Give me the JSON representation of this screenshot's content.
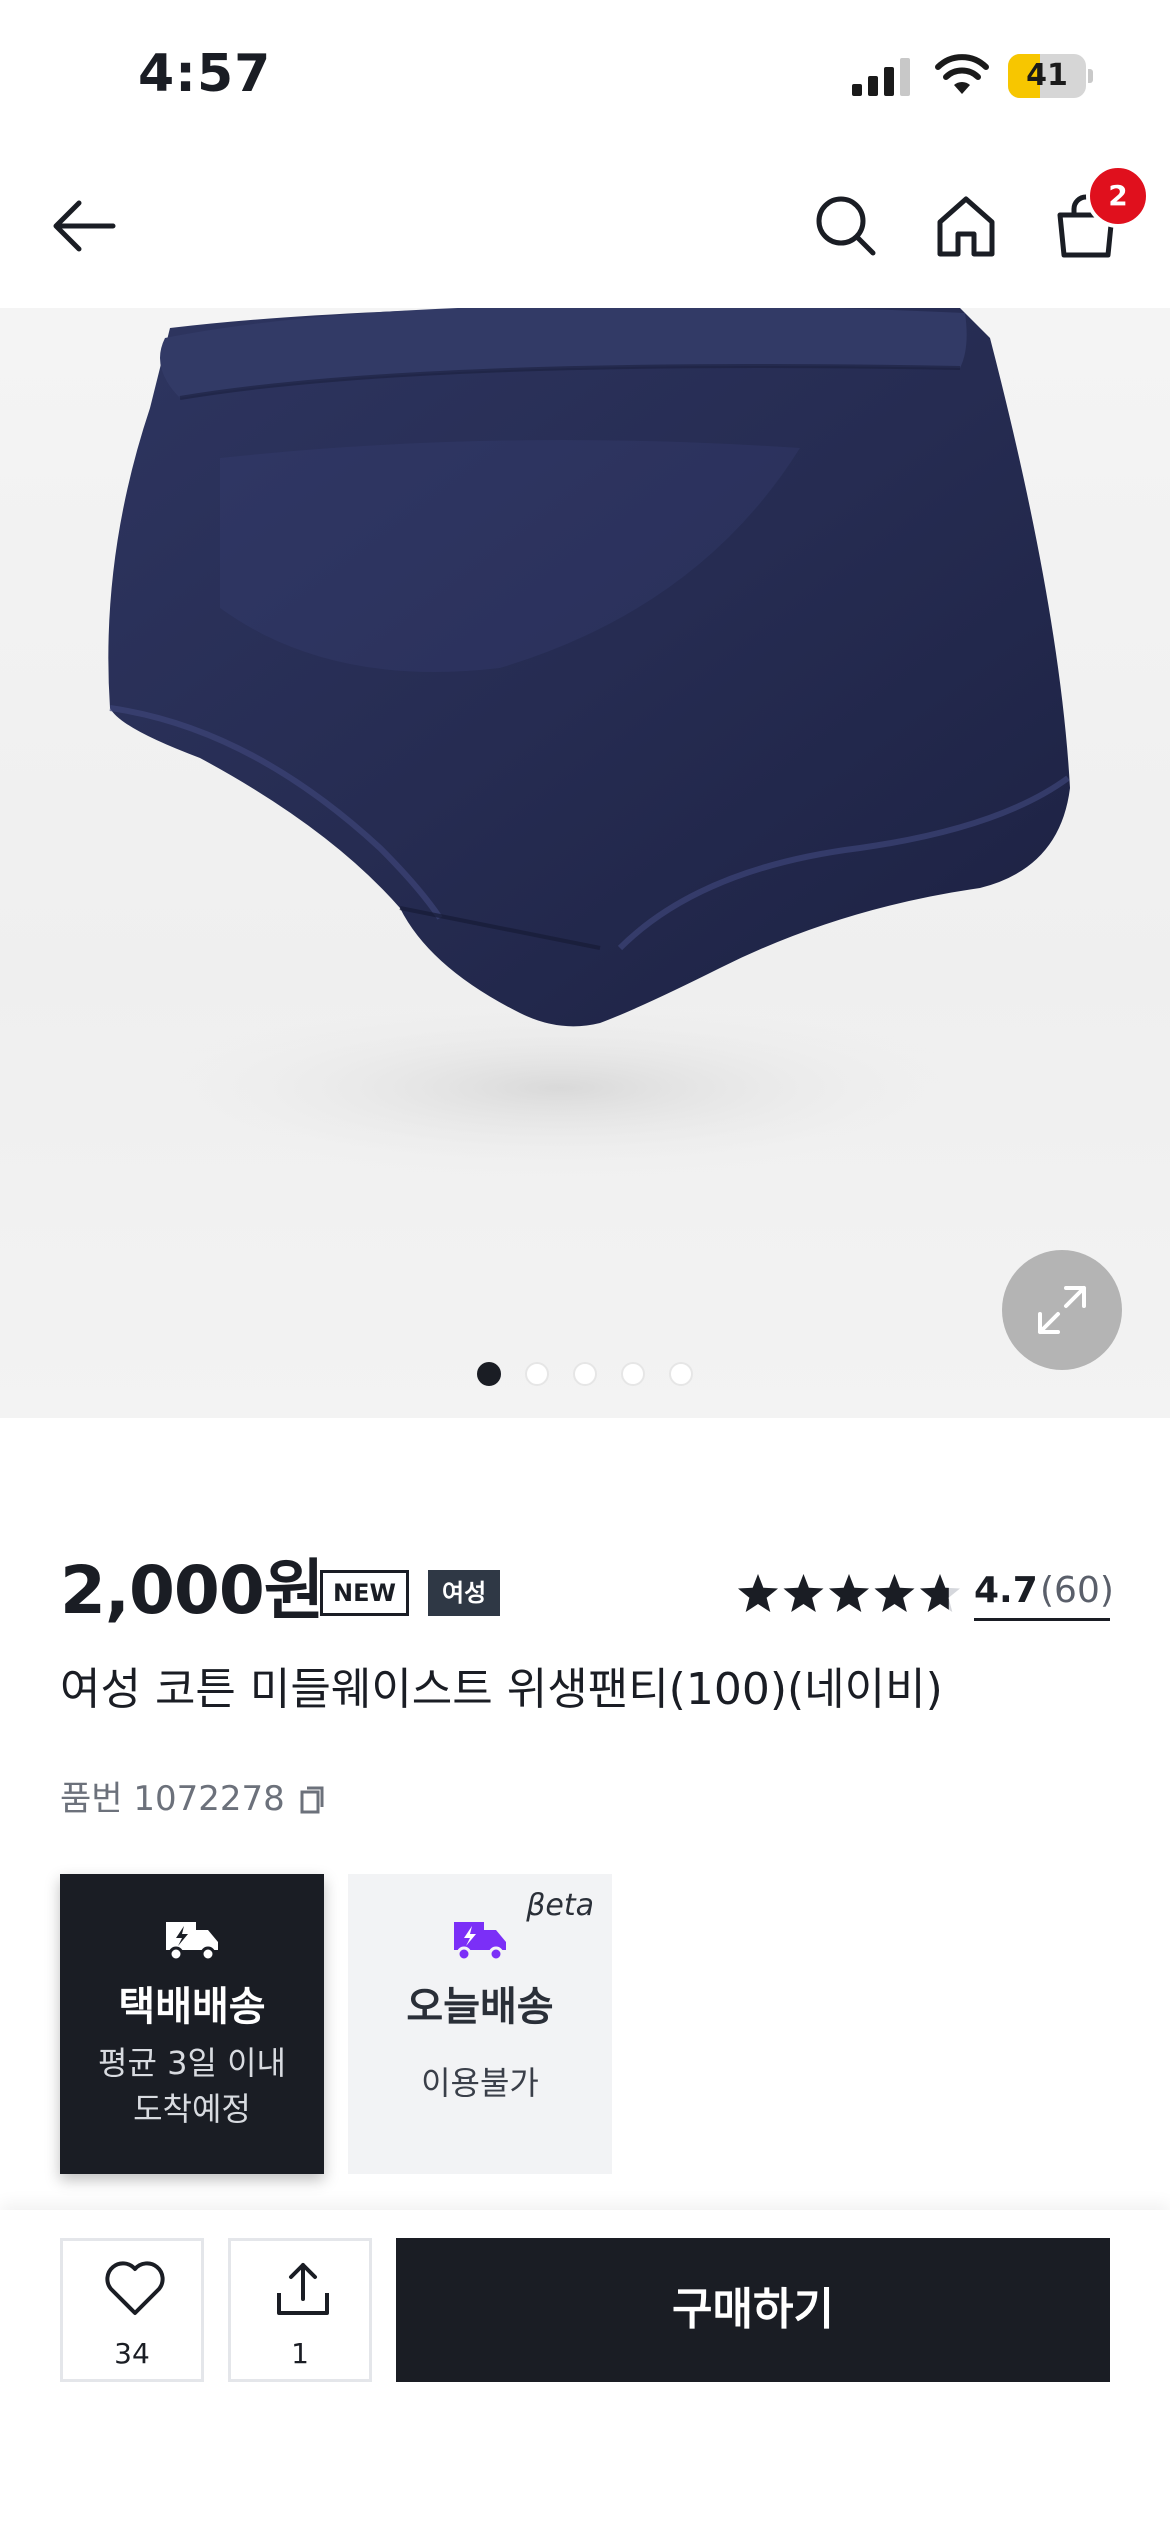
{
  "status_bar": {
    "time": "4:57",
    "battery": "41",
    "battery_level": 0.41
  },
  "nav": {
    "cart_count": "2",
    "icons": [
      "back-arrow-icon",
      "search-icon",
      "home-icon",
      "shopping-bag-icon"
    ]
  },
  "gallery": {
    "total_images": 5,
    "current_index": 1,
    "zoom_icon": "expand-icon"
  },
  "product": {
    "price": "2,000원",
    "tag_new": "NEW",
    "tag_gender": "여성",
    "rating_value": "4.7",
    "rating_count": "(60)",
    "rating_stars": 4.7,
    "name": "여성 코튼 미들웨이스트 위생팬티(100)(네이비)",
    "code_label": "품번 1072278"
  },
  "delivery": {
    "parcel": {
      "title": "택배배송",
      "sub_line1": "평균 3일 이내",
      "sub_line2": "도착예정"
    },
    "today": {
      "title": "오늘배송",
      "sub": "이용불가",
      "badge": "βeta",
      "accent_color": "#7b2ff7"
    }
  },
  "bottom_bar": {
    "like_count": "34",
    "share_count": "1",
    "buy_label": "구매하기"
  },
  "colors": {
    "primary_dark": "#1a1d24",
    "badge_red": "#e0101d"
  }
}
